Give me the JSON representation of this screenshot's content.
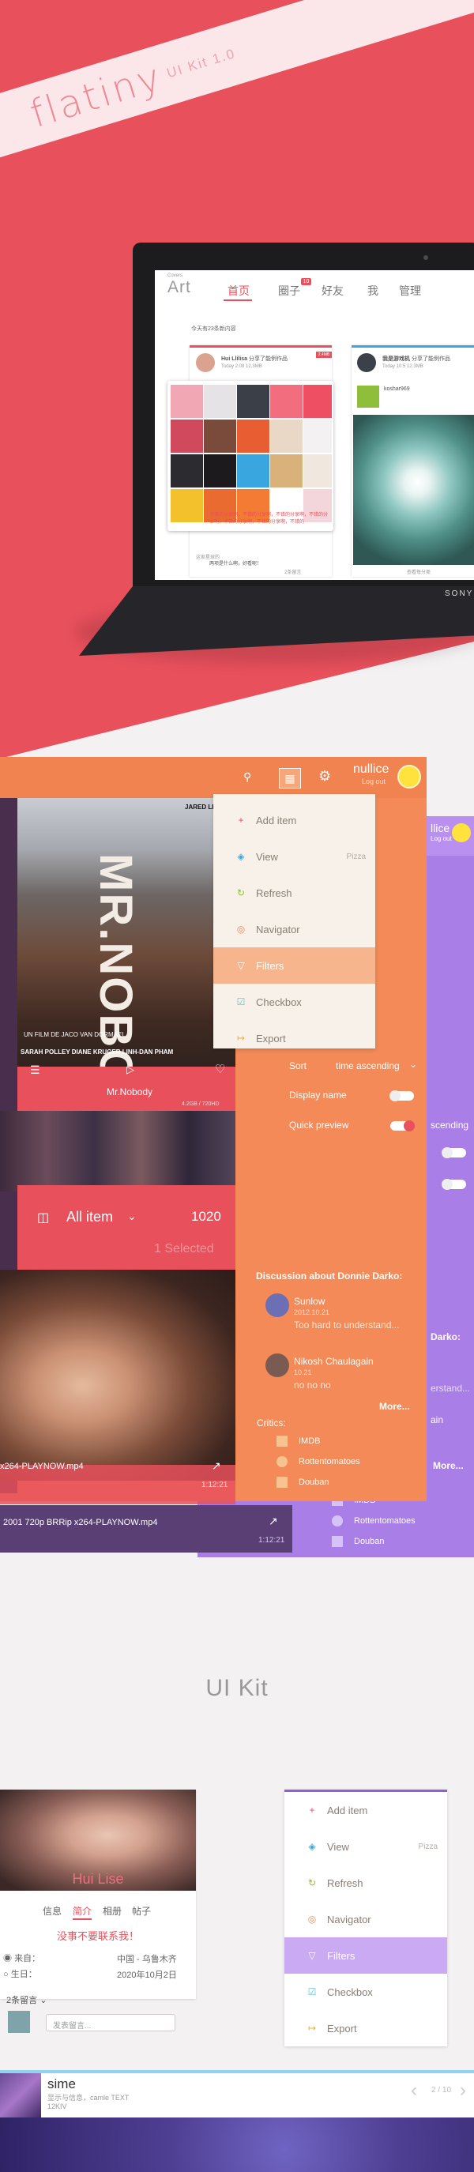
{
  "hero": {
    "brand": "flatiny",
    "tagline": "UI Kit 1.0",
    "laptop_brand": "SONY",
    "app": {
      "logo_small": "Covers",
      "logo": "Art",
      "nav": [
        "首页",
        "圈子",
        "好友",
        "我",
        "管理"
      ],
      "badge": "10",
      "feed_info": "今天有23条新内容",
      "card1": {
        "user": "Hui Llilisa",
        "action": "分享了能例作品",
        "meta": "Today 2:08   12.3MB",
        "tag": "2.4MB",
        "text": "不错的分享啊，不错的分享啊，不错的分享啊，不错的分享啊，不错的分享啊，不错的分享啊，不错的",
        "more": "2条留言",
        "comment_user": "这家星球的",
        "comment_text": "两项是什么啊，好看呢！"
      },
      "card2": {
        "user": "我是游戏机",
        "action": "分享了能例作品",
        "meta": "Today 10:5   12.3MB",
        "sub_user": "koshar969",
        "footer": "查看每分类"
      }
    }
  },
  "app2": {
    "user_name": "nullice",
    "logout": "Log out",
    "menu": [
      {
        "label": "Add item",
        "icon": "+"
      },
      {
        "label": "View",
        "icon": "◈",
        "extra": "Pizza"
      },
      {
        "label": "Refresh",
        "icon": "↻"
      },
      {
        "label": "Navigator",
        "icon": "◎"
      },
      {
        "label": "Filters",
        "icon": "▽"
      },
      {
        "label": "Checkbox",
        "icon": "☑"
      },
      {
        "label": "Export",
        "icon": "↦"
      }
    ],
    "poster_title": "MR.NOBODY",
    "poster_credit": "JARED LETO",
    "poster_director": "UN FILM DE JACO VAN DORMAEL",
    "poster_cast": "SARAH POLLEY  DIANE KRUGER  LINH-DAN PHAM",
    "movie_name": "Mr.Nobody",
    "movie_meta": "4.2GB / 720HD",
    "all_item": "All item",
    "count": "1020",
    "selected": "1 Selected",
    "file1": "x264-PLAYNOW.mp4",
    "time1": "1:12:21",
    "file2": "2001 720p BRRip x264-PLAYNOW.mp4",
    "time2": "1:12:21",
    "sort_label": "Sort",
    "sort_value": "time ascending",
    "display_name": "Display name",
    "quick_preview": "Quick preview",
    "discussion_title": "Discussion about Donnie Darko:",
    "comments": [
      {
        "name": "Sunlow",
        "time": "2012.10.21",
        "text": "Too hard to understand..."
      },
      {
        "name": "Nikosh Chaulagain",
        "time": "10.21",
        "text": "no no no"
      }
    ],
    "more": "More...",
    "critics_title": "Critics:",
    "critics": [
      "IMDB",
      "Rottentomatoes",
      "Douban"
    ],
    "purple": {
      "user": "llice",
      "logout": "Log out",
      "sort_value": "scending",
      "discussion": "Darko:",
      "comment": "erstand...",
      "name": "ain",
      "more": "More...",
      "critics": [
        "IMDB",
        "Rottentomatoes",
        "Douban"
      ]
    }
  },
  "uikit": {
    "title": "UI Kit",
    "profile": {
      "name": "Hui Lise",
      "tabs": [
        "信息",
        "简介",
        "相册",
        "帖子"
      ],
      "bio": "没事不要联系我！",
      "from_label": "来自：",
      "from_value": "中国 - 乌鲁木齐",
      "birth_label": "生日：",
      "birth_value": "2020年10月2日",
      "comments": "2条留言",
      "input_placeholder": "发表留言..."
    },
    "menu": [
      {
        "label": "Add item",
        "icon": "+"
      },
      {
        "label": "View",
        "icon": "◈",
        "extra": "Pizza"
      },
      {
        "label": "Refresh",
        "icon": "↻"
      },
      {
        "label": "Navigator",
        "icon": "◎"
      },
      {
        "label": "Filters",
        "icon": "▽"
      },
      {
        "label": "Checkbox",
        "icon": "☑"
      },
      {
        "label": "Export",
        "icon": "↦"
      }
    ],
    "player": {
      "title": "sime",
      "subtitle": "显示与信息，camle TEXT",
      "sub2": "12KIV",
      "pager": "2 / 10"
    }
  },
  "colors": {
    "red": "#e8505c",
    "orange": "#f38a57",
    "purple": "#a97ee6",
    "blue": "#39a6e0"
  }
}
